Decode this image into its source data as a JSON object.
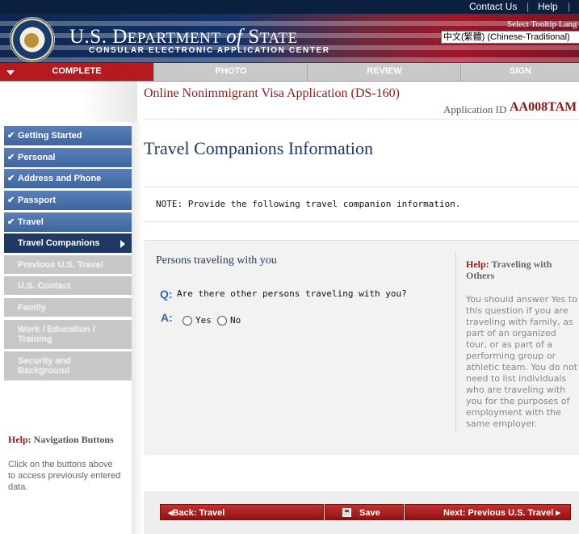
{
  "top_links": [
    "Contact Us",
    "Help"
  ],
  "header": {
    "dept_title_prefix": "U.S. D",
    "dept_title_small1": "EPARTMENT",
    "dept_title_of": " of ",
    "dept_title_s": "S",
    "dept_title_small2": "TATE",
    "dept_subtitle": "CONSULAR ELECTRONIC APPLICATION CENTER",
    "tooltip_label": "Select Tooltip Lang",
    "language_value": "中文(繁體)  (Chinese-Traditional)"
  },
  "progress": [
    "COMPLETE",
    "PHOTO",
    "REVIEW",
    "SIGN"
  ],
  "app": {
    "title": "Online Nonimmigrant Visa Application (DS-160)",
    "id_label": "Application ID",
    "id_value": "AA008TAM"
  },
  "page_title": "Travel Companions Information",
  "nav": {
    "items": [
      {
        "label": "Getting Started",
        "state": "done"
      },
      {
        "label": "Personal",
        "state": "done"
      },
      {
        "label": "Address and Phone",
        "state": "done"
      },
      {
        "label": "Passport",
        "state": "done"
      },
      {
        "label": "Travel",
        "state": "done"
      },
      {
        "label": "Travel Companions",
        "state": "current"
      },
      {
        "label": "Previous U.S. Travel",
        "state": "todo"
      },
      {
        "label": "U.S. Contact",
        "state": "todo"
      },
      {
        "label": "Family",
        "state": "todo"
      },
      {
        "label": "Work / Education / Training",
        "state": "todo"
      },
      {
        "label": "Security and Background",
        "state": "todo"
      }
    ]
  },
  "note": "NOTE: Provide the following travel companion information.",
  "section": {
    "title": "Persons traveling with you",
    "q_marker": "Q:",
    "question": "Are there other persons traveling with you?",
    "a_marker": "A:",
    "options": [
      "Yes",
      "No"
    ]
  },
  "help": {
    "prefix": "Help:",
    "title": "Traveling with Others",
    "body": "You should answer Yes to this question if you are traveling with family, as part of an organized tour, or as part of a performing group or athletic team. You do not need to list individuals who are traveling with you for the purposes of employment with the same employer."
  },
  "nav_help": {
    "prefix": "Help:",
    "title": "Navigation Buttons",
    "body": "Click on the buttons above to access previously entered data."
  },
  "buttons": {
    "back": "Back: Travel",
    "save": "Save",
    "next": "Next: Previous U.S. Travel"
  }
}
